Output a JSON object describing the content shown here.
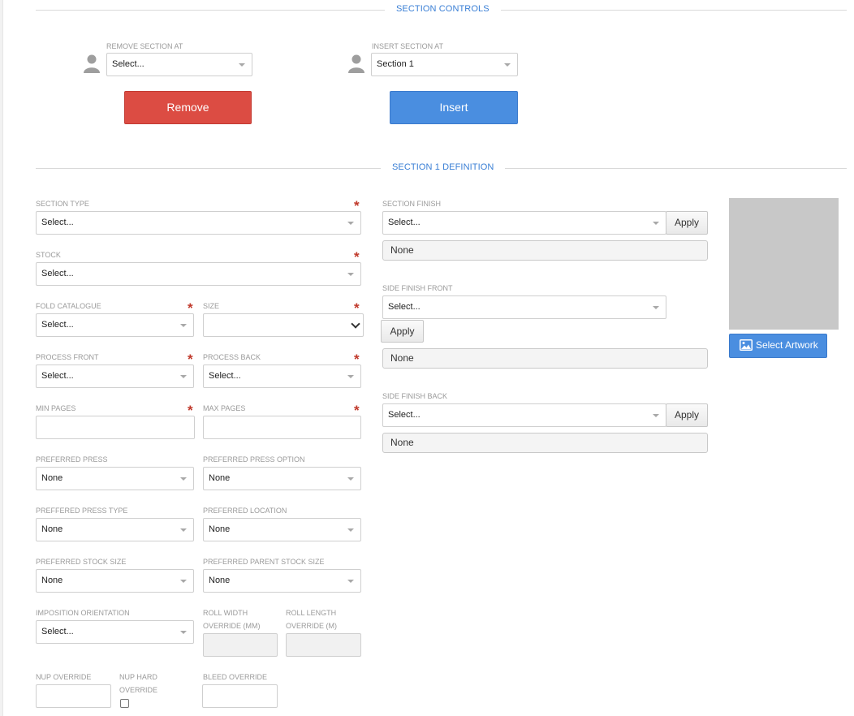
{
  "section_controls": {
    "title": "SECTION CONTROLS",
    "remove_label": "REMOVE SECTION AT",
    "remove_value": "Select...",
    "insert_label": "INSERT SECTION AT",
    "insert_value": "Section 1",
    "remove_button": "Remove",
    "insert_button": "Insert"
  },
  "definition": {
    "title": "SECTION 1 DEFINITION",
    "section_type": {
      "label": "SECTION TYPE",
      "value": "Select...",
      "required": true
    },
    "stock": {
      "label": "STOCK",
      "value": "Select...",
      "required": true
    },
    "fold_catalogue": {
      "label": "FOLD CATALOGUE",
      "value": "Select...",
      "required": true
    },
    "size": {
      "label": "SIZE",
      "value": "",
      "required": true
    },
    "process_front": {
      "label": "PROCESS FRONT",
      "value": "Select...",
      "required": true
    },
    "process_back": {
      "label": "PROCESS BACK",
      "value": "Select...",
      "required": true
    },
    "min_pages": {
      "label": "MIN PAGES",
      "value": "",
      "required": true
    },
    "max_pages": {
      "label": "MAX PAGES",
      "value": "",
      "required": true
    },
    "preferred_press": {
      "label": "PREFERRED PRESS",
      "value": "None"
    },
    "preferred_press_option": {
      "label": "PREFERRED PRESS OPTION",
      "value": "None"
    },
    "preffered_press_type": {
      "label": "PREFFERED PRESS TYPE",
      "value": "None"
    },
    "preferred_location": {
      "label": "PREFERRED LOCATION",
      "value": "None"
    },
    "preferred_stock_size": {
      "label": "PREFERRED STOCK SIZE",
      "value": "None"
    },
    "preferred_parent_stock_size": {
      "label": "PREFERRED PARENT STOCK SIZE",
      "value": "None"
    },
    "imposition_orientation": {
      "label": "IMPOSITION ORIENTATION",
      "value": "Select..."
    },
    "roll_width_override": {
      "label_line1": "ROLL WIDTH",
      "label_line2": "OVERRIDE (MM)",
      "value": ""
    },
    "roll_length_override": {
      "label_line1": "ROLL LENGTH",
      "label_line2": "OVERRIDE (M)",
      "value": ""
    },
    "nup_override": {
      "label": "NUP OVERRIDE",
      "value": ""
    },
    "nup_hard_override": {
      "label_line1": "NUP HARD",
      "label_line2": "OVERRIDE",
      "checked": false
    },
    "bleed_override": {
      "label": "BLEED OVERRIDE",
      "value": ""
    },
    "section_finish": {
      "label": "SECTION FINISH",
      "value": "Select...",
      "apply": "Apply",
      "applied": "None"
    },
    "side_finish_front": {
      "label": "SIDE FINISH FRONT",
      "value": "Select...",
      "apply": "Apply",
      "applied": "None"
    },
    "side_finish_back": {
      "label": "SIDE FINISH BACK",
      "value": "Select...",
      "apply": "Apply",
      "applied": "None"
    },
    "select_artwork": "Select Artwork"
  },
  "colors": {
    "accent": "#3a7fd5",
    "remove": "#dc4c43",
    "insert": "#4a8ee0",
    "required": "#c0392b"
  }
}
